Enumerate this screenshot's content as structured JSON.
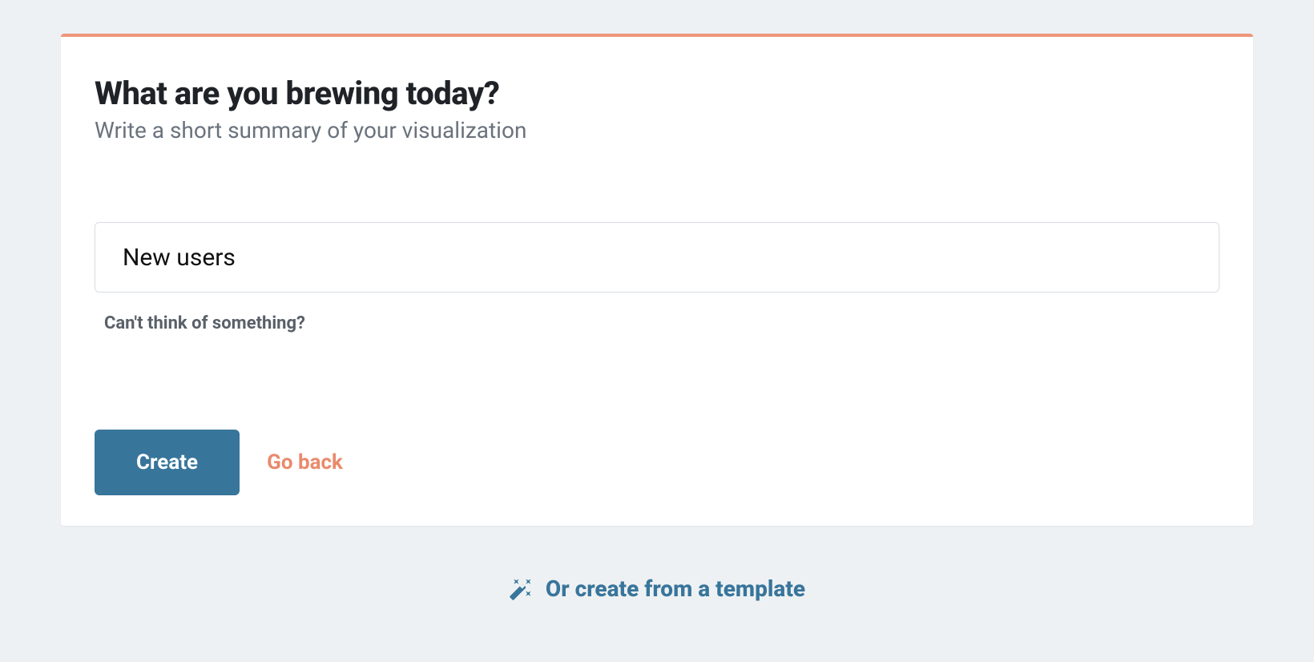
{
  "card": {
    "title": "What are you brewing today?",
    "subtitle": "Write a short summary of your visualization",
    "input_value": "New users",
    "hint": "Can't think of something?",
    "create_label": "Create",
    "back_label": "Go back"
  },
  "footer": {
    "template_link": "Or create from a template"
  }
}
